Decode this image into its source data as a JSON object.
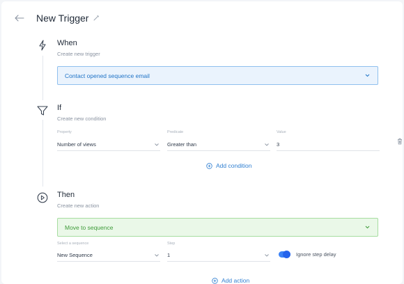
{
  "header": {
    "title": "New Trigger"
  },
  "when": {
    "title": "When",
    "subtitle": "Create new trigger",
    "selected": "Contact opened sequence email"
  },
  "if": {
    "title": "If",
    "subtitle": "Create new condition",
    "property_label": "Property",
    "property_value": "Number of views",
    "predicate_label": "Predicate",
    "predicate_value": "Greater than",
    "value_label": "Value",
    "value_value": "3",
    "add_condition": "Add condition"
  },
  "then": {
    "title": "Then",
    "subtitle": "Create new action",
    "selected": "Move to sequence",
    "sequence_label": "Select a sequence",
    "sequence_value": "New Sequence",
    "step_label": "Step",
    "step_value": "1",
    "ignore_delay_label": "Ignore step delay",
    "ignore_delay_on": true,
    "add_action": "Add action"
  },
  "colors": {
    "when_accent": "#1f73c6",
    "then_accent": "#3f9b3a",
    "link": "#2f7fd1",
    "toggle": "#2563eb"
  },
  "icons": [
    "arrow-left-icon",
    "pencil-icon",
    "lightning-icon",
    "filter-icon",
    "play-circle-icon",
    "chevron-down-icon",
    "plus-circle-icon",
    "trash-icon"
  ]
}
